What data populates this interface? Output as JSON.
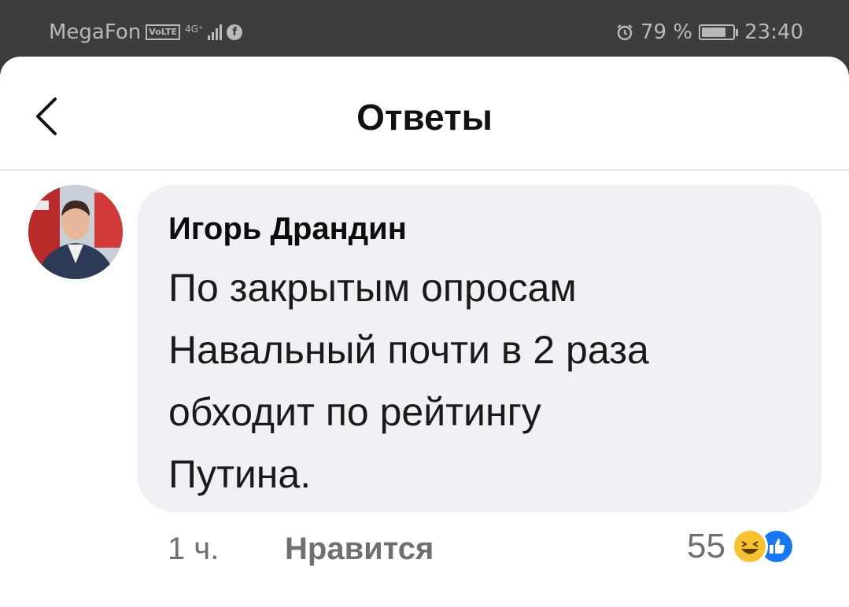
{
  "status_bar": {
    "carrier": "MegaFon",
    "volte": "VoLTE",
    "network": "4G⁺",
    "battery_percent": "79 %",
    "battery_level": 0.79,
    "time": "23:40"
  },
  "header": {
    "title": "Ответы"
  },
  "comment": {
    "author": "Игорь Драндин",
    "text": "По закрытым опросам\nНавальный почти в 2 раза\nобходит по рейтингу\nПутина.",
    "time": "1 ч.",
    "like_label": "Нравится",
    "reaction_count": "55"
  },
  "colors": {
    "bubble": "#eff1f4",
    "status_bar": "#3d3d3d",
    "meta_text": "#707070",
    "like_reaction": "#1877f2",
    "haha_reaction": "#f7c230"
  },
  "icons": [
    "back-chevron-icon",
    "alarm-icon",
    "battery-icon",
    "signal-icon",
    "haha-reaction-icon",
    "like-reaction-icon"
  ]
}
